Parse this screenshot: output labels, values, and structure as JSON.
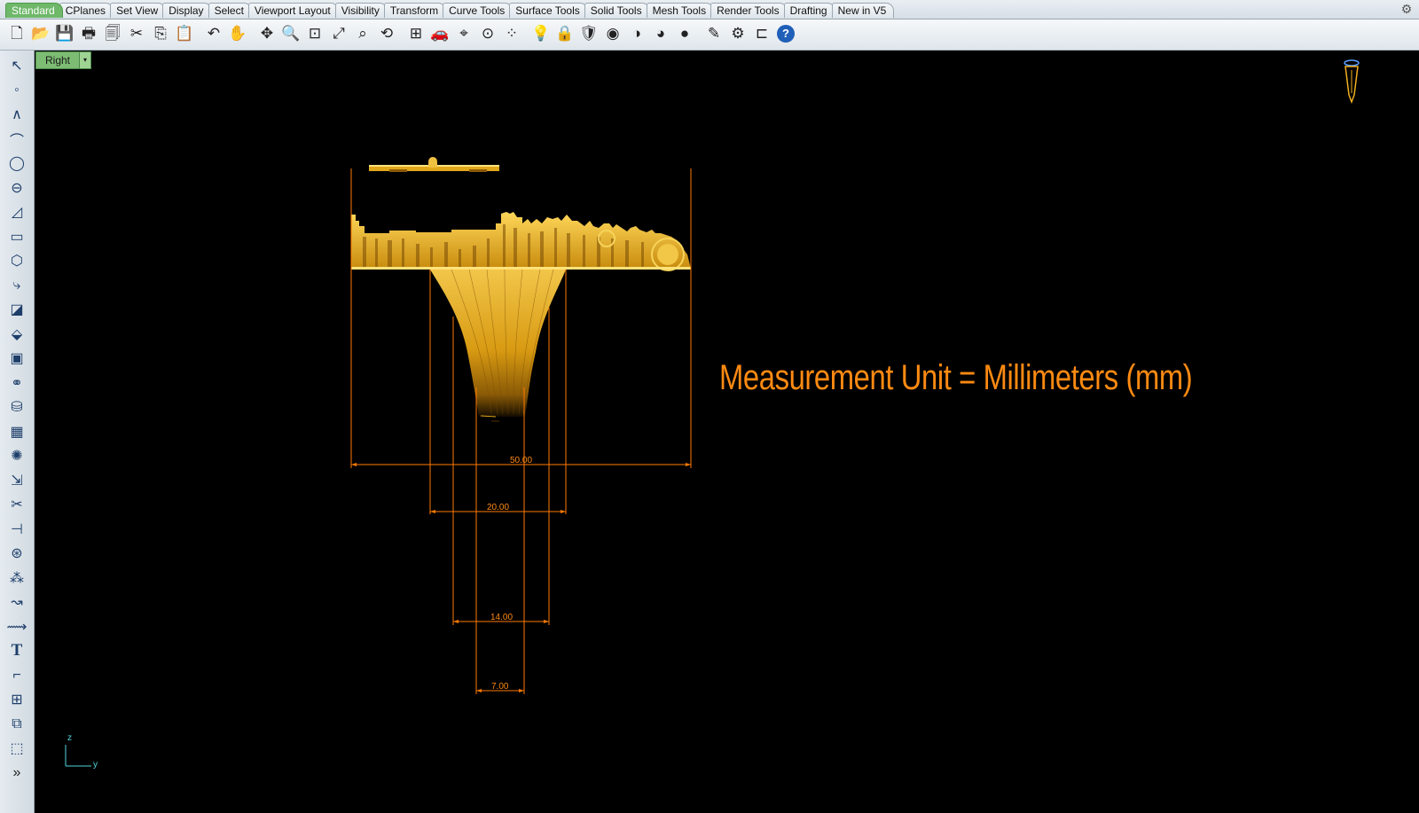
{
  "tabs": [
    {
      "label": "Standard",
      "active": true
    },
    {
      "label": "CPlanes"
    },
    {
      "label": "Set View"
    },
    {
      "label": "Display"
    },
    {
      "label": "Select"
    },
    {
      "label": "Viewport Layout"
    },
    {
      "label": "Visibility"
    },
    {
      "label": "Transform"
    },
    {
      "label": "Curve Tools"
    },
    {
      "label": "Surface Tools"
    },
    {
      "label": "Solid Tools"
    },
    {
      "label": "Mesh Tools"
    },
    {
      "label": "Render Tools"
    },
    {
      "label": "Drafting"
    },
    {
      "label": "New in V5"
    }
  ],
  "toolbar_icons": [
    {
      "name": "new-file-icon",
      "glyph": "🗋"
    },
    {
      "name": "open-folder-icon",
      "glyph": "📂"
    },
    {
      "name": "save-icon",
      "glyph": "💾"
    },
    {
      "name": "print-icon",
      "glyph": "🖶"
    },
    {
      "name": "export-icon",
      "glyph": "🗐"
    },
    {
      "name": "cut-icon",
      "glyph": "✂"
    },
    {
      "name": "copy-icon",
      "glyph": "⎘"
    },
    {
      "name": "paste-icon",
      "glyph": "📋"
    },
    {
      "name": "undo-icon",
      "glyph": "↶"
    },
    {
      "name": "pan-hand-icon",
      "glyph": "✋"
    },
    {
      "name": "move-view-icon",
      "glyph": "✥"
    },
    {
      "name": "zoom-icon",
      "glyph": "🔍"
    },
    {
      "name": "zoom-window-icon",
      "glyph": "⊡"
    },
    {
      "name": "zoom-extents-icon",
      "glyph": "⤢"
    },
    {
      "name": "zoom-selected-icon",
      "glyph": "⌕"
    },
    {
      "name": "rotate-view-icon",
      "glyph": "⟲"
    },
    {
      "name": "four-viewports-icon",
      "glyph": "⊞"
    },
    {
      "name": "car-icon",
      "glyph": "🚗"
    },
    {
      "name": "grid-snap-icon",
      "glyph": "⌖"
    },
    {
      "name": "object-snap-icon",
      "glyph": "⊙"
    },
    {
      "name": "select-points-icon",
      "glyph": "⁘"
    },
    {
      "name": "lightbulb-icon",
      "glyph": "💡"
    },
    {
      "name": "lock-icon",
      "glyph": "🔒"
    },
    {
      "name": "material-icon",
      "glyph": "🛡"
    },
    {
      "name": "color-wheel-icon",
      "glyph": "◉"
    },
    {
      "name": "shaded-sphere-icon",
      "glyph": "◑"
    },
    {
      "name": "rendered-sphere-icon",
      "glyph": "◕"
    },
    {
      "name": "render-icon",
      "glyph": "●"
    },
    {
      "name": "pen-icon",
      "glyph": "✎"
    },
    {
      "name": "options-gear-icon",
      "glyph": "⚙"
    },
    {
      "name": "dimension-icon",
      "glyph": "⊏"
    },
    {
      "name": "help-icon",
      "glyph": "?"
    }
  ],
  "left_tools": [
    "select-arrow-icon",
    "point-icon",
    "polyline-icon",
    "curve-icon",
    "circle-icon",
    "ellipse-icon",
    "arc-icon",
    "rectangle-icon",
    "polygon-icon",
    "fillet-curve-icon",
    "surface-icon",
    "extrude-icon",
    "box-icon",
    "solid-union-icon",
    "cylinder-icon",
    "mesh-icon",
    "explode-icon",
    "transform-icon",
    "trim-icon",
    "split-icon",
    "boolean-icon",
    "group-icon",
    "blend-icon",
    "offset-icon",
    "text-icon",
    "dimension-tool-icon",
    "array-icon",
    "layer-icon",
    "block-icon",
    "more-tools-icon"
  ],
  "viewport": {
    "name": "Right",
    "dropdown_glyph": "▾",
    "label": "Measurement Unit = Millimeters (mm)",
    "axes": {
      "z": "z",
      "y": "y"
    },
    "dimensions": [
      "50.00",
      "20.00",
      "14.00",
      "7.00"
    ]
  },
  "colors": {
    "accent": "#ff8a12",
    "gold": "#e8b21a",
    "viewport_bg": "#000000",
    "active_tab": "#6fb86a"
  }
}
